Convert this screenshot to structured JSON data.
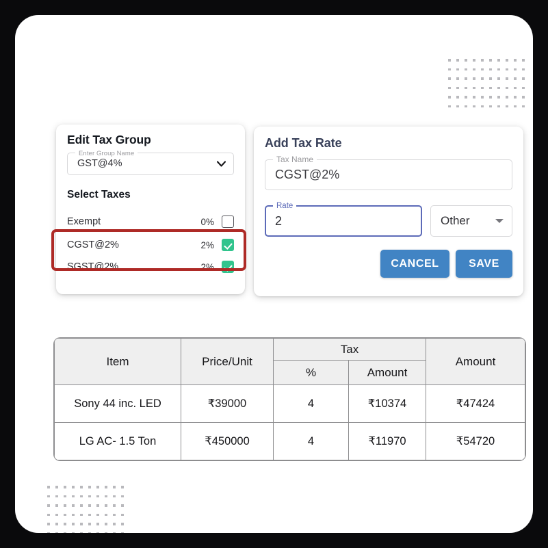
{
  "edit_tax_group": {
    "title": "Edit Tax Group",
    "group_name_field": {
      "legend": "Enter Group Name",
      "value": "GST@4%"
    },
    "select_taxes_title": "Select Taxes",
    "taxes": [
      {
        "name": "Exempt",
        "percent": "0%",
        "checked": false
      },
      {
        "name": "CGST@2%",
        "percent": "2%",
        "checked": true
      },
      {
        "name": "SGST@2%",
        "percent": "2%",
        "checked": true
      }
    ]
  },
  "add_tax_rate": {
    "title": "Add Tax Rate",
    "tax_name_field": {
      "legend": "Tax Name",
      "value": "CGST@2%"
    },
    "rate_field": {
      "legend": "Rate",
      "value": "2"
    },
    "type_select": {
      "value": "Other"
    },
    "cancel_label": "CANCEL",
    "save_label": "SAVE"
  },
  "invoice_table": {
    "headers": {
      "item": "Item",
      "price_per_unit": "Price/Unit",
      "tax": "Tax",
      "tax_percent": "%",
      "tax_amount": "Amount",
      "amount": "Amount"
    },
    "rows": [
      {
        "item": "Sony 44 inc. LED",
        "price": "₹39000",
        "tax_percent": "4",
        "tax_amount": "₹10374",
        "amount": "₹47424"
      },
      {
        "item": "LG AC- 1.5 Ton",
        "price": "₹450000",
        "tax_percent": "4",
        "tax_amount": "₹11970",
        "amount": "₹54720"
      }
    ]
  },
  "colors": {
    "accent_blue": "#4184c4",
    "checkbox_green": "#31c48d",
    "highlight_red": "#ae2a26",
    "focus_indigo": "#5c6ab8",
    "frame_black": "#0a0a0c"
  }
}
